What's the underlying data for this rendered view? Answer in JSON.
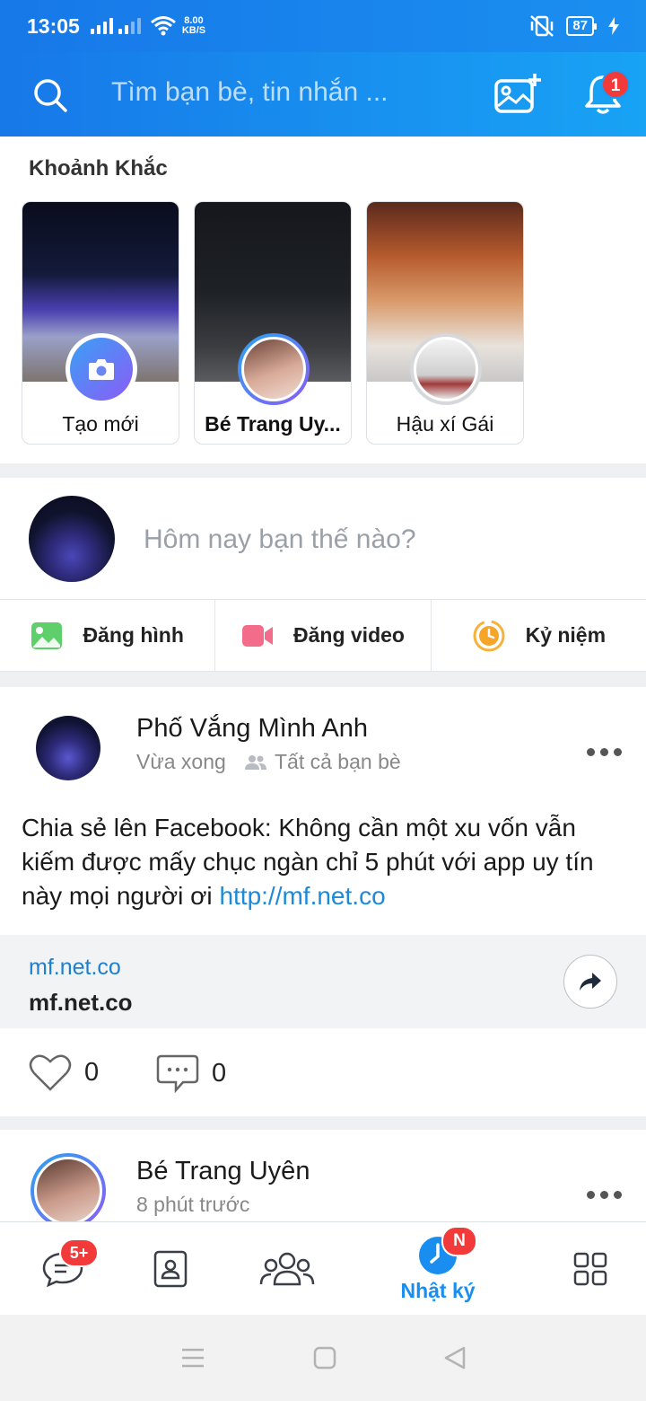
{
  "status_bar": {
    "time": "13:05",
    "net_speed_value": "8.00",
    "net_speed_unit": "KB/S",
    "battery": "87"
  },
  "header": {
    "search_placeholder": "Tìm bạn bè, tin nhắn ...",
    "notification_count": "1"
  },
  "moments": {
    "title": "Khoảnh Khắc",
    "items": [
      {
        "label": "Tạo mới"
      },
      {
        "label": "Bé Trang Uy..."
      },
      {
        "label": "Hậu xí Gái"
      }
    ]
  },
  "composer": {
    "placeholder": "Hôm nay bạn thế nào?",
    "actions": [
      {
        "label": "Đăng hình",
        "icon": "image-icon"
      },
      {
        "label": "Đăng video",
        "icon": "video-camera-icon"
      },
      {
        "label": "Kỷ niệm",
        "icon": "memory-clock-icon"
      }
    ]
  },
  "post": {
    "author": "Phố Vắng Mình Anh",
    "time": "Vừa xong",
    "audience": "Tất cả bạn bè",
    "body": "Chia sẻ lên Facebook: Không cần một xu vốn vẫn kiếm được mấy chục ngàn chỉ 5 phút với app uy tín này mọi người ơi ",
    "body_link": "http://mf.net.co",
    "link_card": {
      "domain": "mf.net.co",
      "title": "mf.net.co"
    },
    "likes": "0",
    "comments": "0"
  },
  "post2": {
    "author": "Bé Trang Uyên",
    "time": "8 phút trước"
  },
  "bottom_nav": {
    "messages_badge": "5+",
    "diary_badge": "N",
    "diary_label": "Nhật ký"
  },
  "colors": {
    "brand_blue": "#1a8ef0",
    "badge_red": "#f23a3a"
  }
}
